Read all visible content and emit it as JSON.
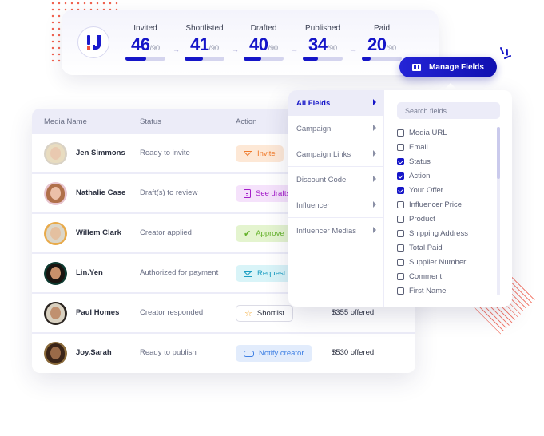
{
  "colors": {
    "accent": "#1515c8",
    "decor": "#f0533f"
  },
  "pipeline": {
    "logo": "brand-logo",
    "stages": [
      {
        "label": "Invited",
        "count": "46",
        "total": "/90",
        "progress": 0.51
      },
      {
        "label": "Shortlisted",
        "count": "41",
        "total": "/90",
        "progress": 0.46
      },
      {
        "label": "Drafted",
        "count": "40",
        "total": "/90",
        "progress": 0.44
      },
      {
        "label": "Published",
        "count": "34",
        "total": "/90",
        "progress": 0.38
      },
      {
        "label": "Paid",
        "count": "20",
        "total": "/90",
        "progress": 0.22
      }
    ]
  },
  "manage_fields": {
    "label": "Manage Fields",
    "icon": "columns-icon"
  },
  "table": {
    "headers": {
      "name": "Media Name",
      "status": "Status",
      "action": "Action"
    },
    "rows": [
      {
        "name": "Jen Simmons",
        "status": "Ready to invite",
        "action": "Invite",
        "action_icon": "mail-icon",
        "offer": ""
      },
      {
        "name": "Nathalie Case",
        "status": "Draft(s) to review",
        "action": "See drafts",
        "action_icon": "document-icon",
        "offer": ""
      },
      {
        "name": "Willem Clark",
        "status": "Creator applied",
        "action": "Approve",
        "action_icon": "check-icon",
        "offer": ""
      },
      {
        "name": "Lin.Yen",
        "status": "Authorized for payment",
        "action": "Request info",
        "action_icon": "mail-icon",
        "offer": ""
      },
      {
        "name": "Paul Homes",
        "status": "Creator responded",
        "action": "Shortlist",
        "action_icon": "star-icon",
        "offer": "$355 offered"
      },
      {
        "name": "Joy.Sarah",
        "status": "Ready to publish",
        "action": "Notify creator",
        "action_icon": "handshake-icon",
        "offer": "$530 offered"
      }
    ]
  },
  "panel": {
    "categories": [
      {
        "label": "All Fields",
        "active": true
      },
      {
        "label": "Campaign",
        "active": false
      },
      {
        "label": "Campaign Links",
        "active": false
      },
      {
        "label": "Discount Code",
        "active": false
      },
      {
        "label": "Influencer",
        "active": false
      },
      {
        "label": "Influencer Medias",
        "active": false
      }
    ],
    "search_placeholder": "Search fields",
    "fields": [
      {
        "label": "Media URL",
        "checked": false
      },
      {
        "label": "Email",
        "checked": false
      },
      {
        "label": "Status",
        "checked": true
      },
      {
        "label": "Action",
        "checked": true
      },
      {
        "label": "Your Offer",
        "checked": true
      },
      {
        "label": "Influencer Price",
        "checked": false
      },
      {
        "label": "Product",
        "checked": false
      },
      {
        "label": "Shipping Address",
        "checked": false
      },
      {
        "label": "Total Paid",
        "checked": false
      },
      {
        "label": "Supplier Number",
        "checked": false
      },
      {
        "label": "Comment",
        "checked": false
      },
      {
        "label": "First Name",
        "checked": false
      }
    ]
  }
}
